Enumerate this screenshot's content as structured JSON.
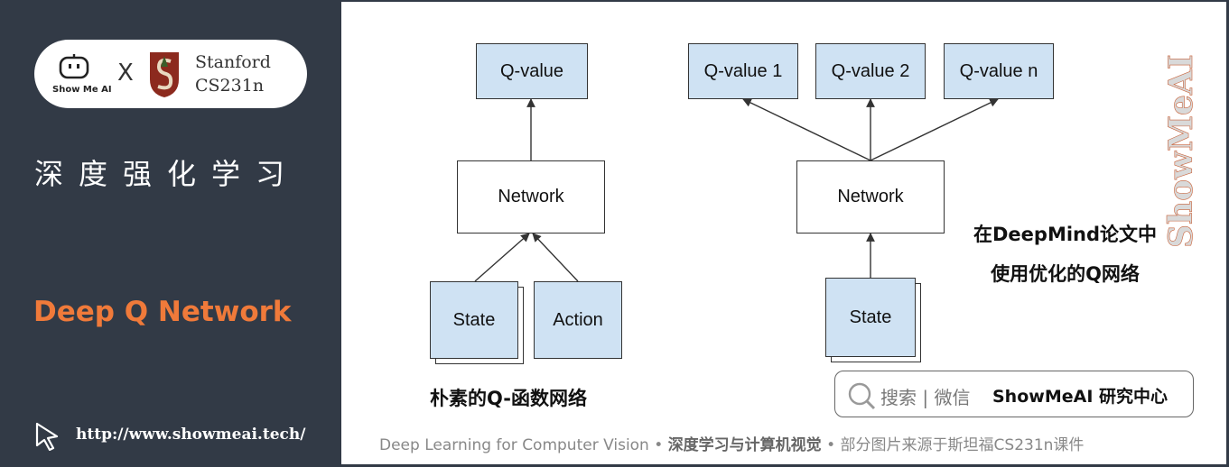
{
  "logo": {
    "robot_label": "Show Me AI",
    "cross": "X",
    "stanford_line1": "Stanford",
    "stanford_line2": "CS231n"
  },
  "sidebar": {
    "cn_title": "深度强化学习",
    "en_title": "Deep Q Network",
    "url": "http://www.showmeai.tech/",
    "title_color": "#f07a3a",
    "background": "#323a46"
  },
  "diagram_left": {
    "output": "Q-value",
    "network": "Network",
    "input_state": "State",
    "input_action": "Action",
    "caption": "朴素的Q-函数网络"
  },
  "diagram_right": {
    "outputs": [
      "Q-value 1",
      "Q-value 2",
      "Q-value n"
    ],
    "network": "Network",
    "input_state": "State",
    "note_line1": "在DeepMind论文中",
    "note_line2": "使用优化的Q网络"
  },
  "colors": {
    "q_box_fill": "#cfe2f3"
  },
  "watermark": "ShowMeAI",
  "search": {
    "prefix": "搜索 | 微信",
    "brand": "ShowMeAI 研究中心"
  },
  "footer": {
    "part1": "Deep Learning for Computer Vision",
    "sep1": " • ",
    "part2": "深度学习与计算机视觉",
    "sep2": " • ",
    "part3": "部分图片来源于斯坦福CS231n课件"
  }
}
